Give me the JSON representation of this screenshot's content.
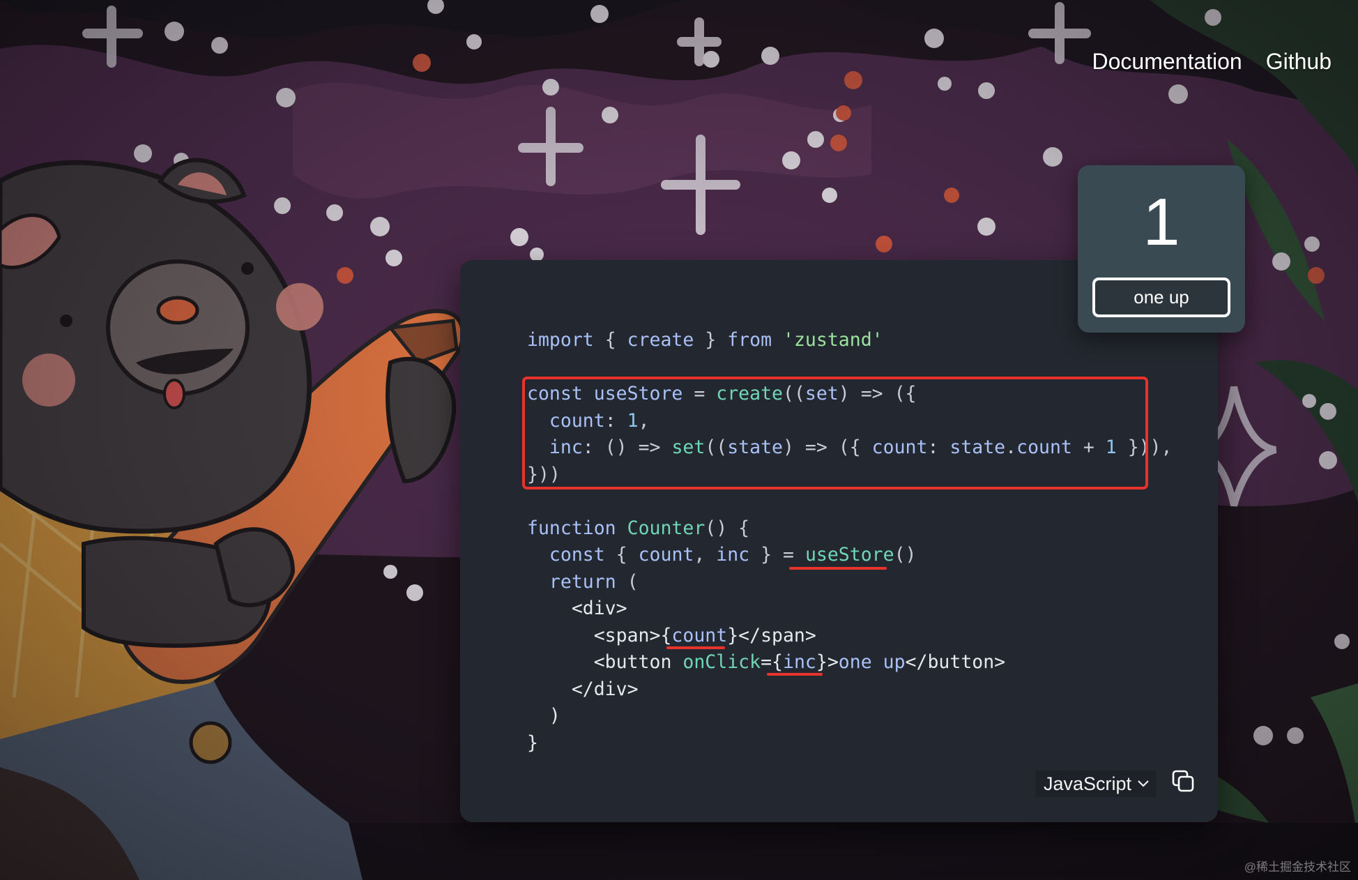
{
  "nav": {
    "documentation": "Documentation",
    "github": "Github"
  },
  "demo": {
    "count": "1",
    "button_label": "one up"
  },
  "code": {
    "l1": {
      "kw1": "import",
      "p1": " { ",
      "id1": "create",
      "p2": " } ",
      "kw2": "from",
      "p3": " ",
      "str": "'zustand'"
    },
    "l2": {
      "kw": "const",
      "p1": " ",
      "id": "useStore",
      "p2": " = ",
      "fn": "create",
      "p3": "((",
      "id2": "set",
      "p4": ") => ({"
    },
    "l3": {
      "indent": "  ",
      "id": "count",
      "p1": ": ",
      "num": "1",
      "p2": ","
    },
    "l4": {
      "indent": "  ",
      "id": "inc",
      "p1": ": () => ",
      "fn": "set",
      "p2": "((",
      "id2": "state",
      "p3": ") => ({ ",
      "id3": "count",
      "p4": ": ",
      "id4": "state",
      "p5": ".",
      "id5": "count",
      "p6": " + ",
      "num": "1",
      "p7": " })),"
    },
    "l5": "}))",
    "l6": {
      "kw": "function",
      "p1": " ",
      "fn": "Counter",
      "p2": "() {"
    },
    "l7": {
      "indent": "  ",
      "kw": "const",
      "p1": " { ",
      "id1": "count",
      "p2": ", ",
      "id2": "inc",
      "p3": " } = ",
      "fn": "useStore",
      "p4": "()"
    },
    "l8": {
      "indent": "  ",
      "kw": "return",
      "p1": " ("
    },
    "l9": "    <div>",
    "l10": {
      "p1": "      <span>{",
      "id": "count",
      "p2": "}</span>"
    },
    "l11": {
      "p1": "      <button ",
      "attr": "onClick",
      "p2": "={",
      "id": "inc",
      "p3": "}>",
      "txt1": "one",
      "p4": " ",
      "txt2": "up",
      "p5": "</button>"
    },
    "l12": "    </div>",
    "l13": "  )",
    "l14": "}"
  },
  "language": {
    "selected": "JavaScript"
  },
  "icons": {
    "chevron": "chevron-down-icon",
    "copy": "copy-icon"
  },
  "watermark": "@稀土掘金技术社区",
  "colors": {
    "highlight": "#e8322c",
    "panel_bg": "#23272f",
    "card_bg": "#3a4a52"
  }
}
